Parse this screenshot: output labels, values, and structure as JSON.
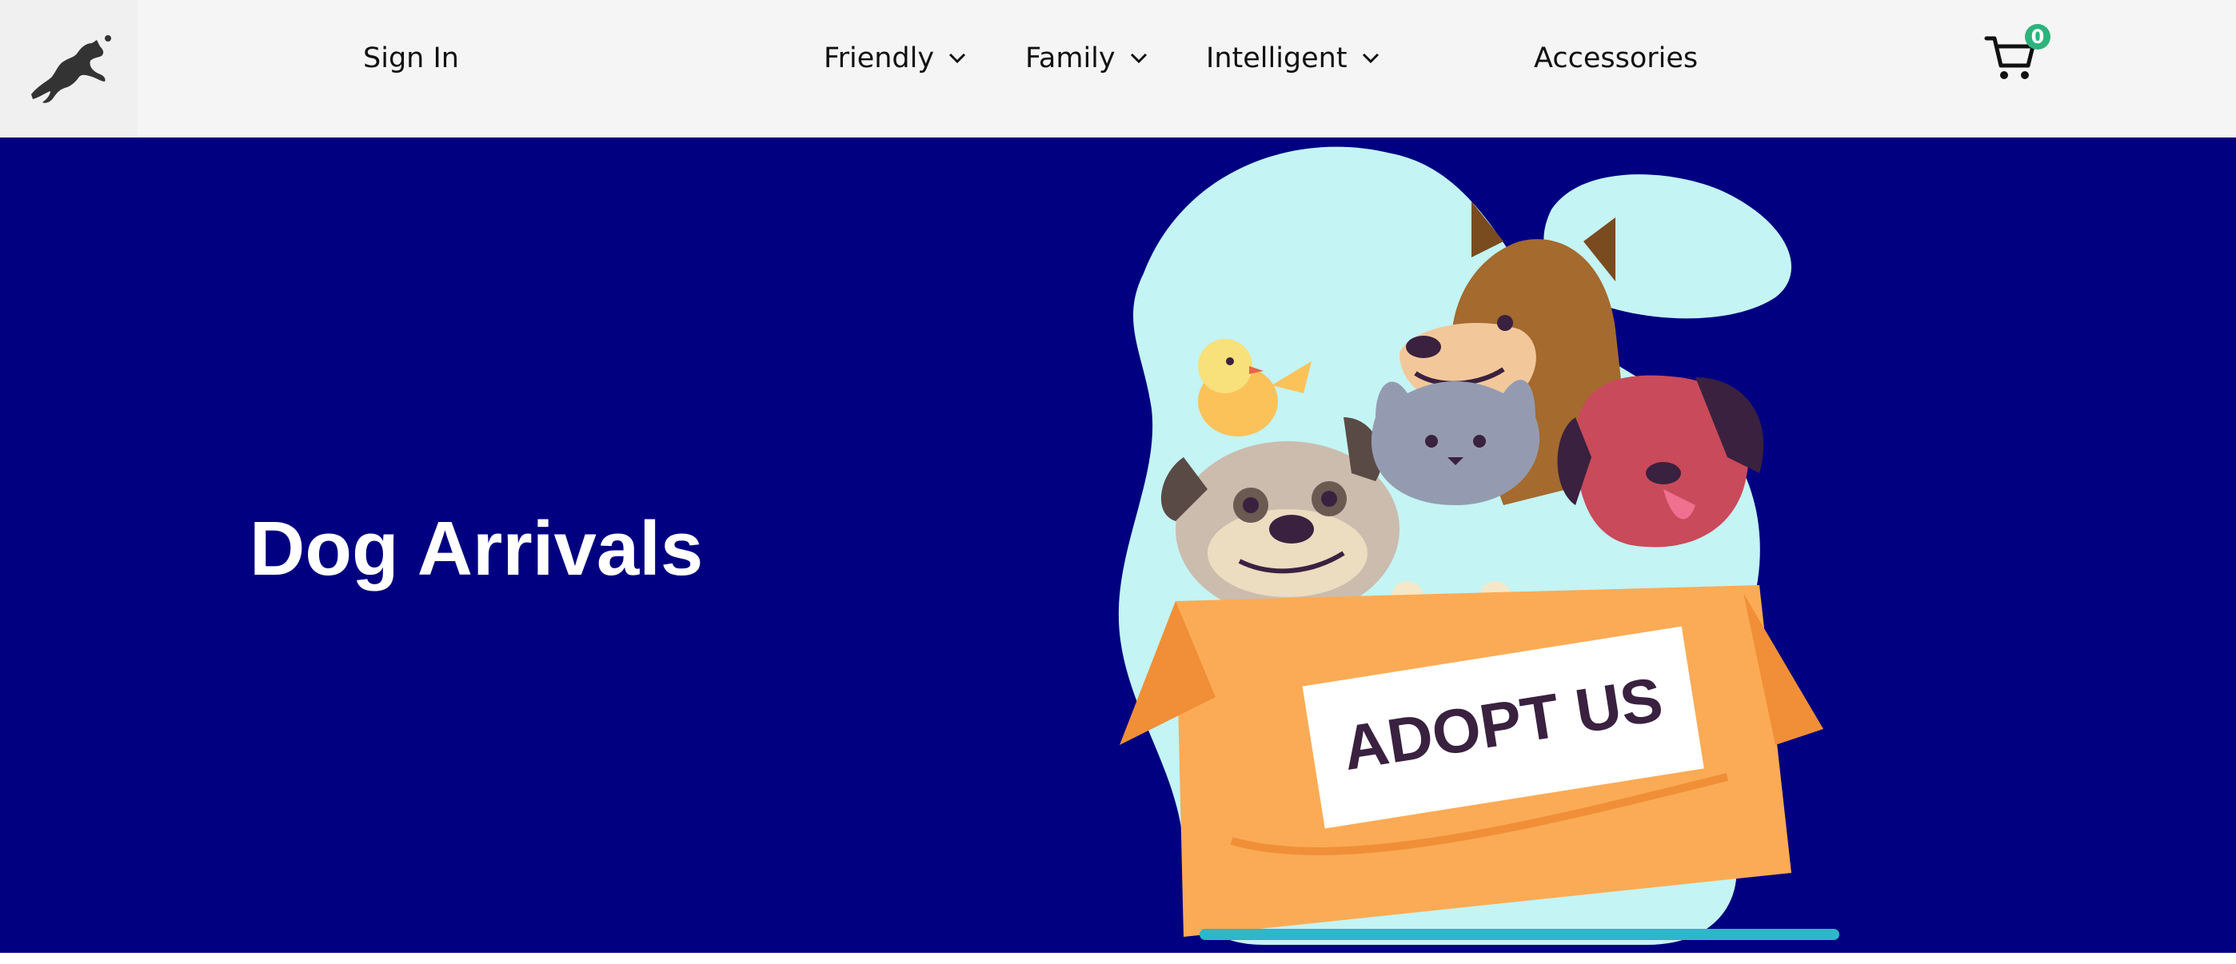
{
  "nav": {
    "logo_alt": "jumping-dog-logo",
    "sign_in": "Sign In",
    "items": [
      {
        "label": "Friendly",
        "has_dropdown": true
      },
      {
        "label": "Family",
        "has_dropdown": true
      },
      {
        "label": "Intelligent",
        "has_dropdown": true
      }
    ],
    "accessories": "Accessories",
    "cart_count": "0"
  },
  "hero": {
    "title": "Dog Arrivals",
    "box_sign": "ADOPT US",
    "background_color": "#000080"
  },
  "colors": {
    "navbar": "#f5f5f5",
    "badge": "#2db37b",
    "blob": "#c4f4f4",
    "box": "#fbab55"
  }
}
